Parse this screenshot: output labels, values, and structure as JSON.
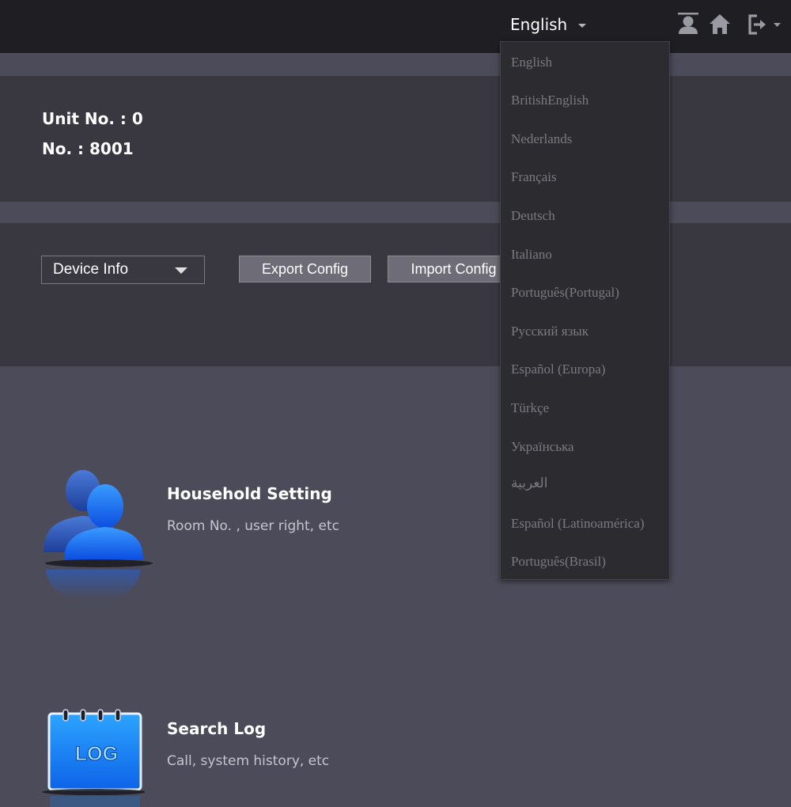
{
  "header": {
    "language": "English",
    "icons": [
      "user-icon",
      "home-icon",
      "logout-icon"
    ]
  },
  "device": {
    "unit_no": "Unit No. : 0",
    "no": "No. : 8001"
  },
  "config": {
    "selected": "Device Info",
    "export_label": "Export Config",
    "import_label": "Import Config"
  },
  "features": [
    {
      "title": "Household Setting",
      "desc": "Room No. , user right, etc",
      "icon": "users-icon"
    },
    {
      "title": "Search Log",
      "desc": "Call, system history, etc",
      "icon": "log-icon",
      "icon_text": "LOG"
    }
  ],
  "language_menu": [
    "English",
    "BritishEnglish",
    "Nederlands",
    "Français",
    "Deutsch",
    "Italiano",
    "Português(Portugal)",
    "Русский язык",
    "Español (Europa)",
    "Türkçe",
    "Українська",
    "العربية",
    "Español (Latinoamérica)",
    "Português(Brasil)"
  ],
  "colors": {
    "topbar": "#1e1e23",
    "panel": "#393841",
    "background": "#4c4b59",
    "menu": "#2b2b30",
    "accent": "#1f7ff0"
  }
}
